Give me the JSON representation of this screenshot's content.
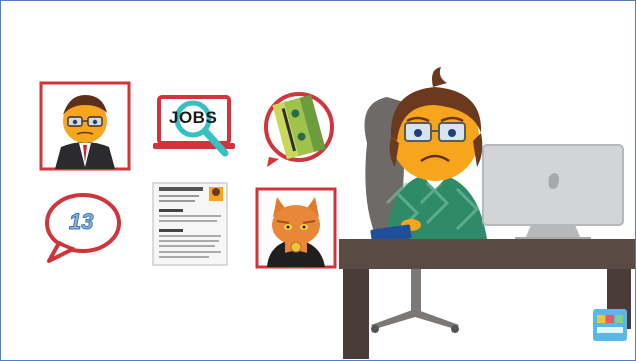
{
  "illustration": {
    "jobs_label": "JOBS",
    "speech_bubble_number": "13"
  },
  "colors": {
    "frame_border": "#4f7fc4",
    "red_frame": "#d2343b",
    "teal": "#35c0c2",
    "desk": "#5a4a44",
    "laptop": "#c9c9cb",
    "sweater_green": "#2f8a6a",
    "hair": "#6b3a1e",
    "face": "#f7a51c",
    "chair": "#6d6a67"
  }
}
